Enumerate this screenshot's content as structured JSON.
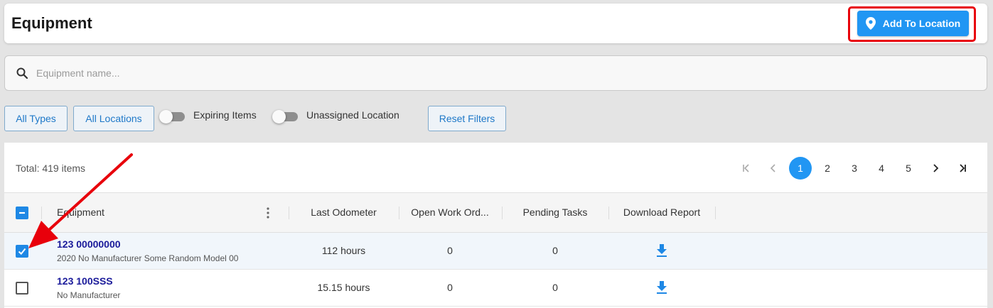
{
  "header": {
    "title": "Equipment",
    "add_button_label": "Add To Location"
  },
  "search": {
    "placeholder": "Equipment name..."
  },
  "filters": {
    "all_types": "All Types",
    "all_locations": "All Locations",
    "expiring_items": "Expiring Items",
    "unassigned_location": "Unassigned Location",
    "reset_filters": "Reset Filters"
  },
  "table": {
    "total": "Total: 419 items",
    "pagination": {
      "pages": [
        "1",
        "2",
        "3",
        "4",
        "5"
      ],
      "active_page": "1"
    },
    "columns": {
      "equipment": "Equipment",
      "last_odometer": "Last Odometer",
      "open_work_orders": "Open Work Ord...",
      "pending_tasks": "Pending Tasks",
      "download_report": "Download Report"
    },
    "rows": [
      {
        "name": "123 00000000",
        "subtitle": "2020 No Manufacturer Some Random Model 00",
        "last_odometer": "112 hours",
        "open_work_orders": "0",
        "pending_tasks": "0",
        "selected": true
      },
      {
        "name": "123 100SSS",
        "subtitle": "No Manufacturer",
        "last_odometer": "15.15 hours",
        "open_work_orders": "0",
        "pending_tasks": "0",
        "selected": false
      }
    ]
  },
  "colors": {
    "primary": "#2196f3",
    "highlight": "#e8000b",
    "link": "#1a1a9a",
    "filter_text": "#1e78c8"
  },
  "icons": {
    "add_button": "location-pin-icon",
    "search": "search-icon",
    "download": "download-icon",
    "pager_first": "first-page-icon",
    "pager_prev": "chevron-left-icon",
    "pager_next": "chevron-right-icon",
    "pager_last": "last-page-icon",
    "column_menu": "kebab-menu-icon"
  }
}
